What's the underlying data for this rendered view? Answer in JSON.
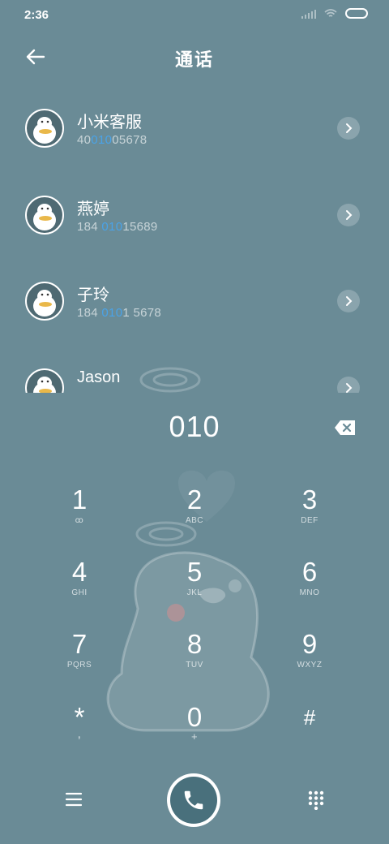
{
  "status_bar": {
    "time": "2:36"
  },
  "header": {
    "title": "通话"
  },
  "contacts": [
    {
      "name": "小米客服",
      "num_pre": "40",
      "num_hl": "010",
      "num_post": "05678"
    },
    {
      "name": "燕婷",
      "num_pre": "184 ",
      "num_hl": "010",
      "num_post": "15689"
    },
    {
      "name": "子玲",
      "num_pre": "184 ",
      "num_hl": "010",
      "num_post": "1 5678"
    },
    {
      "name": "Jason",
      "num_pre": "",
      "num_hl": "",
      "num_post": ""
    }
  ],
  "dialer": {
    "input": "010"
  },
  "keys": [
    {
      "digit": "1",
      "letters": "ꝏ"
    },
    {
      "digit": "2",
      "letters": "ABC"
    },
    {
      "digit": "3",
      "letters": "DEF"
    },
    {
      "digit": "4",
      "letters": "GHI"
    },
    {
      "digit": "5",
      "letters": "JKL"
    },
    {
      "digit": "6",
      "letters": "MNO"
    },
    {
      "digit": "7",
      "letters": "PQRS"
    },
    {
      "digit": "8",
      "letters": "TUV"
    },
    {
      "digit": "9",
      "letters": "WXYZ"
    },
    {
      "digit": "*",
      "letters": ","
    },
    {
      "digit": "0",
      "letters": "+"
    },
    {
      "digit": "#",
      "letters": ""
    }
  ],
  "colors": {
    "background": "#6a8b96",
    "highlight": "#4aa3e8",
    "call_button": "#49707c"
  },
  "icons": [
    "back-arrow-icon",
    "chevron-right-icon",
    "backspace-icon",
    "menu-icon",
    "phone-icon",
    "dialpad-icon"
  ]
}
